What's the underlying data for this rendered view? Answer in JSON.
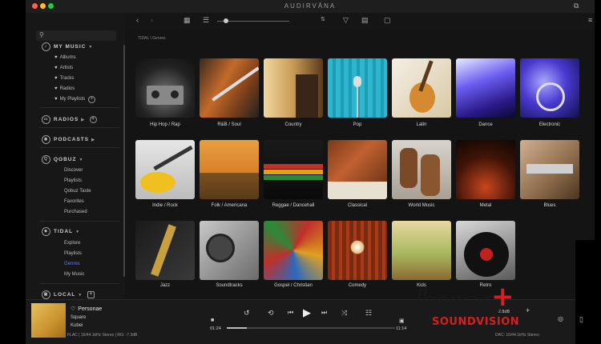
{
  "app": {
    "title": "AUDIRVĀNA"
  },
  "sidebar": {
    "sections": [
      {
        "label": "MY MUSIC",
        "icon": "music-note-icon"
      },
      {
        "label": "RADIOS",
        "icon": "radio-icon"
      },
      {
        "label": "PODCASTS",
        "icon": "podcast-icon"
      },
      {
        "label": "QOBUZ",
        "icon": "qobuz-icon"
      },
      {
        "label": "TIDAL",
        "icon": "tidal-icon"
      },
      {
        "label": "LOCAL",
        "icon": "local-icon"
      }
    ],
    "my_music": [
      "Albums",
      "Artists",
      "Tracks",
      "Radios",
      "My Playlists"
    ],
    "qobuz": [
      "Discover",
      "Playlists",
      "Qobuz Taste",
      "Favorites",
      "Purchased"
    ],
    "tidal": [
      "Explore",
      "Playlists",
      "Genres",
      "My Music"
    ],
    "selected": "Genres"
  },
  "breadcrumb": "TIDAL \\ Genres",
  "genres": [
    "Hip Hop / Rap",
    "R&B / Soul",
    "Country",
    "Pop",
    "Latin",
    "Dance",
    "Electronic",
    "Indie / Rock",
    "Folk / Americana",
    "Reggae / Dancehall",
    "Classical",
    "World Music",
    "Metal",
    "Blues",
    "Jazz",
    "Soundtracks",
    "Gospel / Christian",
    "Comedy",
    "Kids",
    "Retro"
  ],
  "player": {
    "track_title": "Personae",
    "artist": "Square",
    "album": "Kubei",
    "format": "FLAC | 16/44.1kHz Stereo | RG: -7.3dB",
    "time_elapsed": "01:24",
    "time_total": "11:14",
    "dac": "DAC: 16/44.1kHz Stereo",
    "progress": 0.12,
    "volume_db": "-2.8dB"
  },
  "watermark": {
    "brand": "hxos",
    "tagline": "SOUNDVISION"
  },
  "colors": {
    "accent": "#6b7cf0",
    "background": "#141414",
    "sidebar": "#171717",
    "watermark_red": "#d42020"
  }
}
